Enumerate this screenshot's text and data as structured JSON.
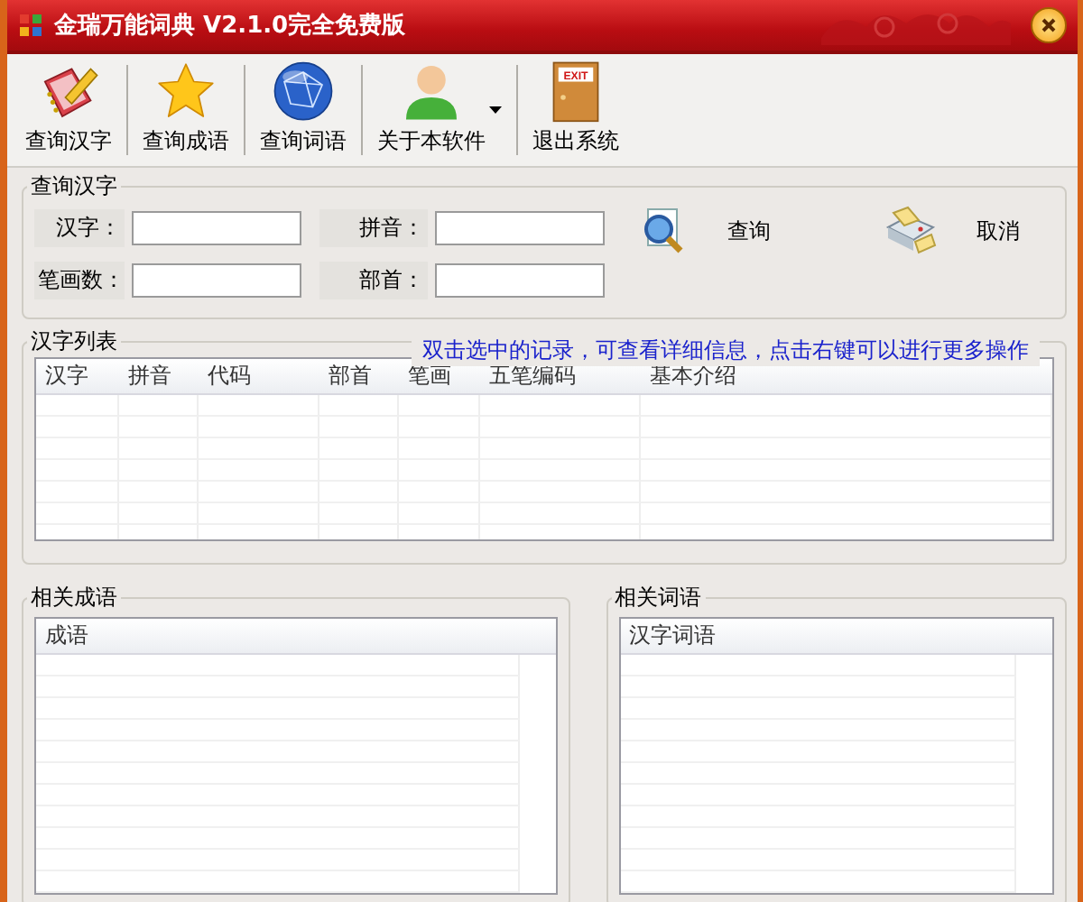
{
  "window": {
    "title": "金瑞万能词典 V2.1.0完全免费版"
  },
  "toolbar": [
    {
      "label": "查询汉字",
      "kind": "book",
      "dropdown": false
    },
    {
      "label": "查询成语",
      "kind": "star",
      "dropdown": false
    },
    {
      "label": "查询词语",
      "kind": "globe",
      "dropdown": false
    },
    {
      "label": "关于本软件",
      "kind": "person",
      "dropdown": true
    },
    {
      "label": "退出系统",
      "kind": "exit",
      "dropdown": false,
      "sign": "EXIT"
    }
  ],
  "search_group": {
    "title": "查询汉字",
    "fields": [
      {
        "label": "汉字："
      },
      {
        "label": "拼音："
      },
      {
        "label": "笔画数："
      },
      {
        "label": "部首："
      }
    ],
    "buttons": [
      {
        "label": "查询",
        "kind": "search"
      },
      {
        "label": "取消",
        "kind": "cancel"
      }
    ]
  },
  "list_group": {
    "title": "汉字列表",
    "hint": "双击选中的记录，可查看详细信息，点击右键可以进行更多操作",
    "columns": [
      "汉字",
      "拼音",
      "代码",
      "部首",
      "笔画",
      "五笔编码",
      "基本介绍"
    ]
  },
  "idiom_group": {
    "title": "相关成语",
    "columns": [
      "成语"
    ]
  },
  "word_group": {
    "title": "相关词语",
    "columns": [
      "汉字词语"
    ]
  }
}
